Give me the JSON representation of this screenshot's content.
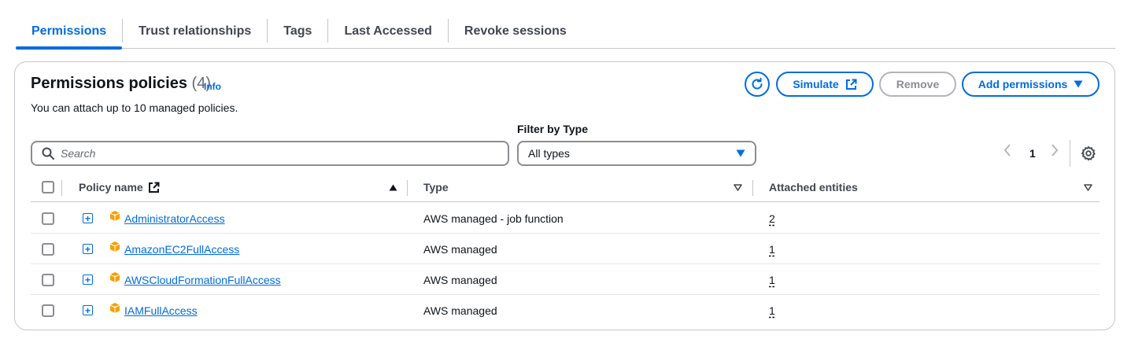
{
  "tabs": [
    {
      "label": "Permissions",
      "active": true
    },
    {
      "label": "Trust relationships",
      "active": false
    },
    {
      "label": "Tags",
      "active": false
    },
    {
      "label": "Last Accessed",
      "active": false
    },
    {
      "label": "Revoke sessions",
      "active": false
    }
  ],
  "panel": {
    "title": "Permissions policies",
    "count": "(4)",
    "info_label": "Info",
    "subtitle": "You can attach up to 10 managed policies."
  },
  "actions": {
    "refresh_icon": "refresh-icon",
    "simulate_label": "Simulate",
    "remove_label": "Remove",
    "add_permissions_label": "Add permissions"
  },
  "filters": {
    "search_placeholder": "Search",
    "filter_label": "Filter by Type",
    "type_selected": "All types"
  },
  "pagination": {
    "current_page": "1"
  },
  "table": {
    "columns": {
      "policy_name": "Policy name",
      "type": "Type",
      "attached_entities": "Attached entities"
    },
    "rows": [
      {
        "name": "AdministratorAccess",
        "type": "AWS managed - job function",
        "attached": "2"
      },
      {
        "name": "AmazonEC2FullAccess",
        "type": "AWS managed",
        "attached": "1"
      },
      {
        "name": "AWSCloudFormationFullAccess",
        "type": "AWS managed",
        "attached": "1"
      },
      {
        "name": "IAMFullAccess",
        "type": "AWS managed",
        "attached": "1"
      }
    ]
  },
  "colors": {
    "accent": "#006ce0",
    "policy_icon": "#f7a000",
    "text": "#0f141a",
    "border": "#c6c6cd"
  }
}
